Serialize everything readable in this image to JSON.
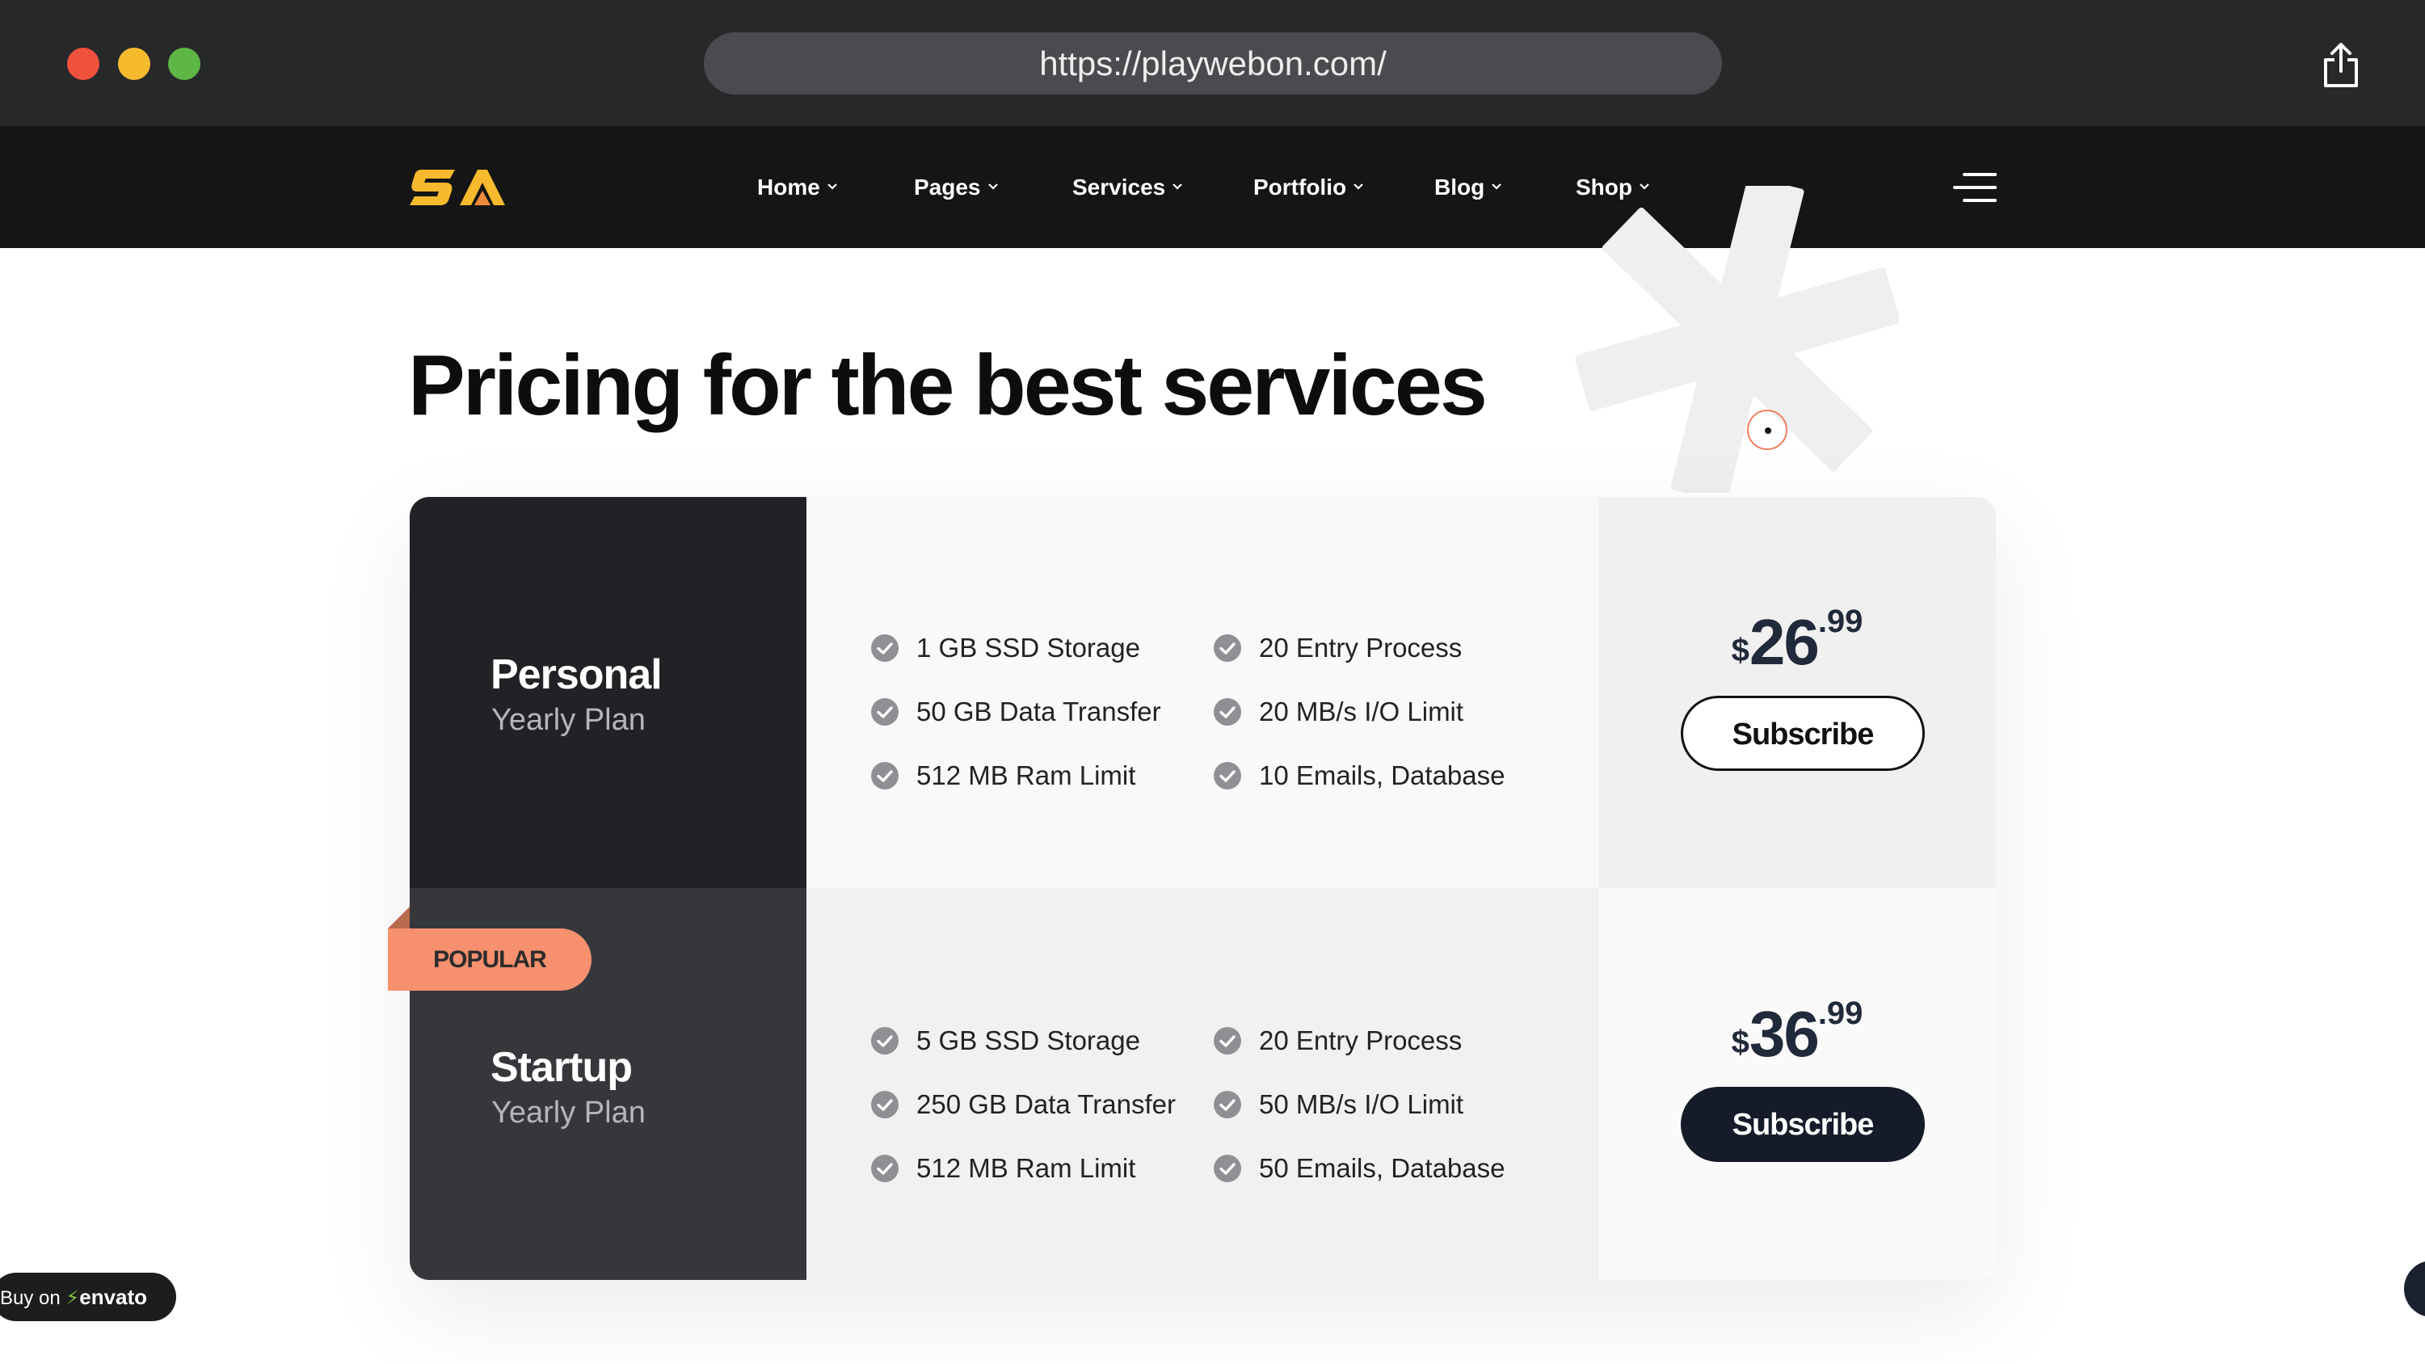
{
  "browser": {
    "url": "https://playwebon.com/",
    "controls": [
      "close",
      "minimize",
      "maximize"
    ],
    "share_icon": "share-icon"
  },
  "site": {
    "logo_text": "SA",
    "nav": [
      {
        "label": "Home"
      },
      {
        "label": "Pages"
      },
      {
        "label": "Services"
      },
      {
        "label": "Portfolio"
      },
      {
        "label": "Blog"
      },
      {
        "label": "Shop"
      }
    ],
    "menu_icon": "hamburger-menu-icon"
  },
  "hero": {
    "title": "Pricing for the best services"
  },
  "plans": [
    {
      "name": "Personal",
      "period": "Yearly Plan",
      "features": [
        "1 GB SSD Storage",
        "50 GB Data Transfer",
        "512 MB Ram Limit",
        "20 Entry Process",
        "20 MB/s I/O Limit",
        "10 Emails, Database"
      ],
      "price": {
        "currency": "$",
        "whole": "26",
        "cents": ".99"
      },
      "cta": "Subscribe"
    },
    {
      "name": "Startup",
      "period": "Yearly Plan",
      "badge": "POPULAR",
      "features": [
        "5 GB SSD Storage",
        "250 GB Data Transfer",
        "512 MB Ram Limit",
        "20 Entry Process",
        "50 MB/s I/O Limit",
        "50 Emails, Database"
      ],
      "price": {
        "currency": "$",
        "whole": "36",
        "cents": ".99"
      },
      "cta": "Subscribe"
    }
  ],
  "floating": {
    "buy_label": "Buy on",
    "envato_brand": "envato"
  },
  "colors": {
    "chrome_bg": "#27282a",
    "nav_bg": "#151515",
    "plan_dark": "#212225",
    "plan_mid": "#35373b",
    "accent": "#f7906e",
    "button_dark": "#161b29"
  }
}
